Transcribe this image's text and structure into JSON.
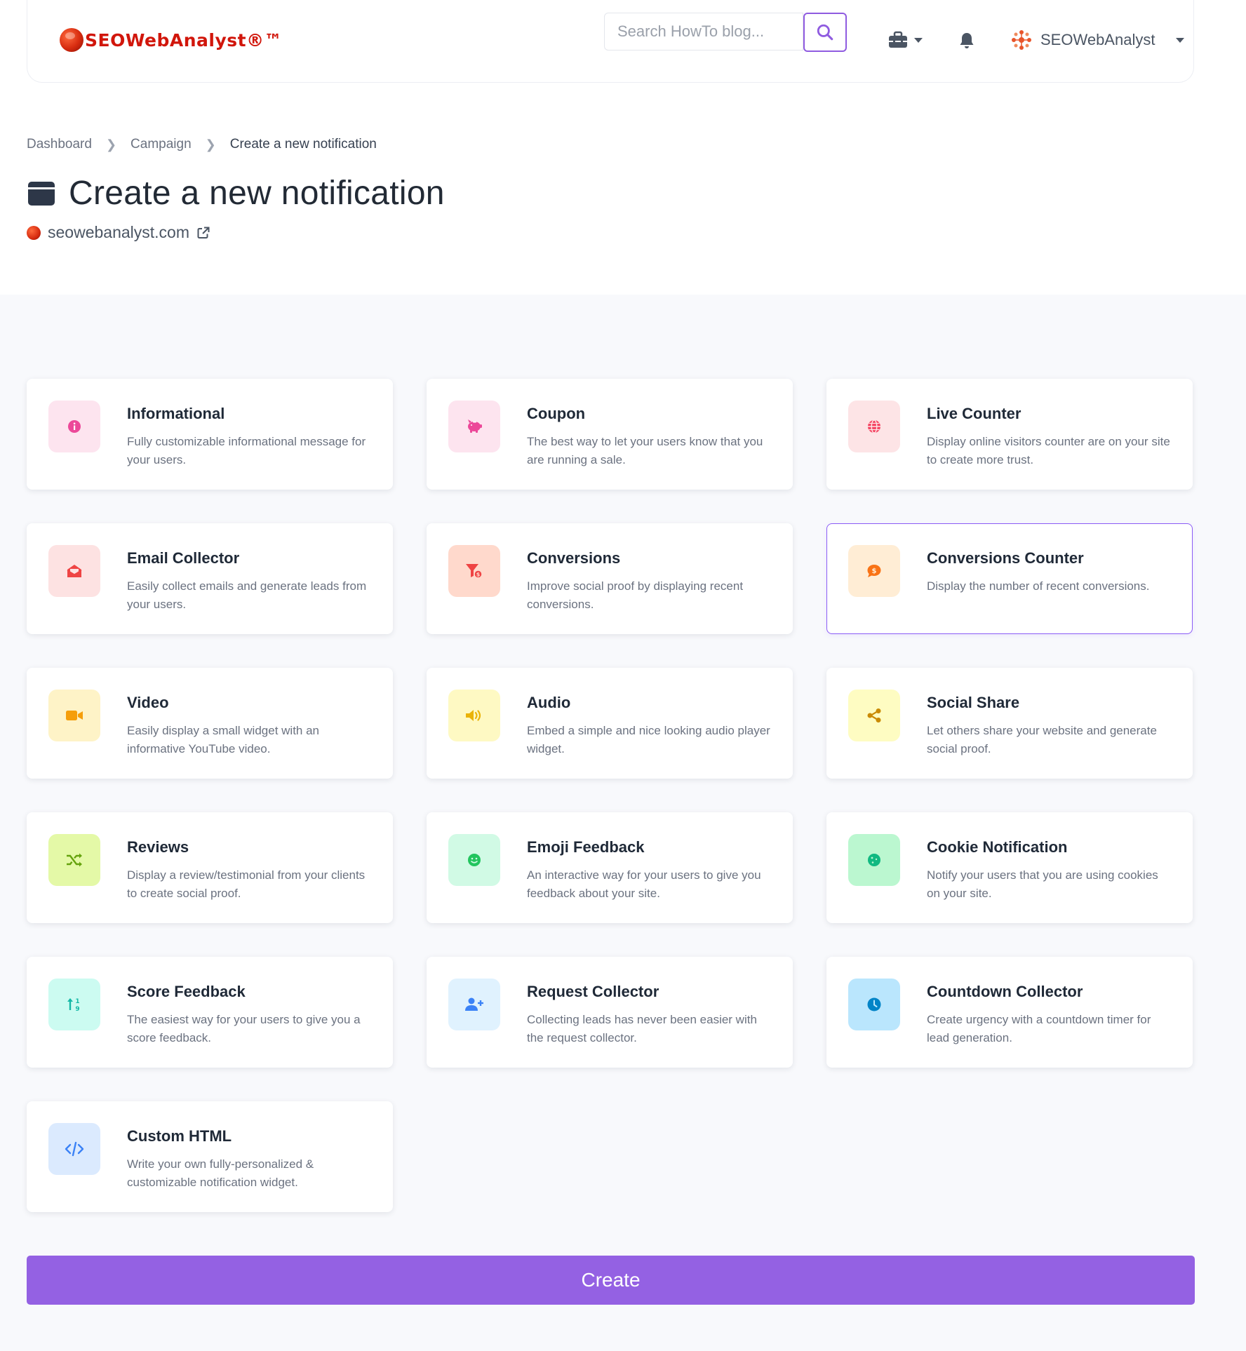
{
  "brand": {
    "name": "SEOWebAnalyst",
    "suffix": "®™"
  },
  "search": {
    "placeholder": "Search HowTo blog..."
  },
  "user": {
    "name": "SEOWebAnalyst"
  },
  "breadcrumb": [
    {
      "label": "Dashboard"
    },
    {
      "label": "Campaign"
    },
    {
      "label": "Create a new notification"
    }
  ],
  "page": {
    "title": "Create a new notification",
    "site": "seowebanalyst.com"
  },
  "cards": [
    {
      "title": "Informational",
      "desc": "Fully customizable informational message for your users.",
      "icon": "info-icon",
      "bg": "#fde4ef",
      "fg": "#ec4899"
    },
    {
      "title": "Coupon",
      "desc": "The best way to let your users know that you are running a sale.",
      "icon": "piggy-bank-icon",
      "bg": "#fde4ef",
      "fg": "#ec4899"
    },
    {
      "title": "Live Counter",
      "desc": "Display online visitors counter are on your site to create more trust.",
      "icon": "globe-icon",
      "bg": "#fde4e6",
      "fg": "#f43f5e"
    },
    {
      "title": "Email Collector",
      "desc": "Easily collect emails and generate leads from your users.",
      "icon": "envelope-open-icon",
      "bg": "#fde2e2",
      "fg": "#ef4444"
    },
    {
      "title": "Conversions",
      "desc": "Improve social proof by displaying recent conversions.",
      "icon": "funnel-dollar-icon",
      "bg": "#ffd9cc",
      "fg": "#ef4444"
    },
    {
      "title": "Conversions Counter",
      "desc": "Display the number of recent conversions.",
      "icon": "comment-dollar-icon",
      "bg": "#ffedd5",
      "fg": "#f97316"
    },
    {
      "title": "Video",
      "desc": "Easily display a small widget with an informative YouTube video.",
      "icon": "video-icon",
      "bg": "#fef3c7",
      "fg": "#f59e0b"
    },
    {
      "title": "Audio",
      "desc": "Embed a simple and nice looking audio player widget.",
      "icon": "volume-icon",
      "bg": "#fef9c3",
      "fg": "#eab308"
    },
    {
      "title": "Social Share",
      "desc": "Let others share your website and generate social proof.",
      "icon": "share-icon",
      "bg": "#fefcc2",
      "fg": "#ca8a04"
    },
    {
      "title": "Reviews",
      "desc": "Display a review/testimonial from your clients to create social proof.",
      "icon": "random-icon",
      "bg": "#e4f9a7",
      "fg": "#65a30d"
    },
    {
      "title": "Emoji Feedback",
      "desc": "An interactive way for your users to give you feedback about your site.",
      "icon": "smile-icon",
      "bg": "#d1fae5",
      "fg": "#22c55e"
    },
    {
      "title": "Cookie Notification",
      "desc": "Notify your users that you are using cookies on your site.",
      "icon": "cookie-icon",
      "bg": "#bbf7d0",
      "fg": "#10b981"
    },
    {
      "title": "Score Feedback",
      "desc": "The easiest way for your users to give you a score feedback.",
      "icon": "sort-numeric-icon",
      "bg": "#ccfbf1",
      "fg": "#14b8a6"
    },
    {
      "title": "Request Collector",
      "desc": "Collecting leads has never been easier with the request collector.",
      "icon": "user-plus-icon",
      "bg": "#e0f2fe",
      "fg": "#3b82f6"
    },
    {
      "title": "Countdown Collector",
      "desc": "Create urgency with a countdown timer for lead generation.",
      "icon": "clock-icon",
      "bg": "#bae6fd",
      "fg": "#0284c7"
    },
    {
      "title": "Custom HTML",
      "desc": "Write your own fully-personalized & customizable notification widget.",
      "icon": "code-icon",
      "bg": "#dbeafe",
      "fg": "#3b82f6"
    }
  ],
  "selected_card": "Conversions Counter",
  "actions": {
    "create_label": "Create"
  },
  "colors": {
    "accent": "#9461e3",
    "selected_border": "#8b5cf6"
  }
}
